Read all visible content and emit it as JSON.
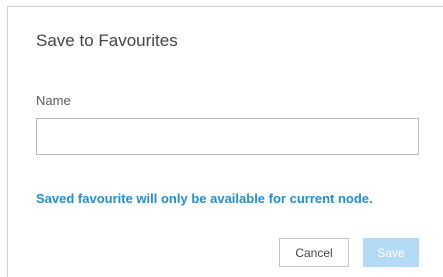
{
  "dialog": {
    "title": "Save to Favourites",
    "name_label": "Name",
    "name_value": "",
    "info_text": "Saved favourite will only be available for current node.",
    "cancel_label": "Cancel",
    "save_label": "Save",
    "save_enabled": false
  },
  "colors": {
    "info_text": "#1e8fd6",
    "save_button_disabled": "#b3dbf6",
    "border": "#b9b9b9"
  }
}
